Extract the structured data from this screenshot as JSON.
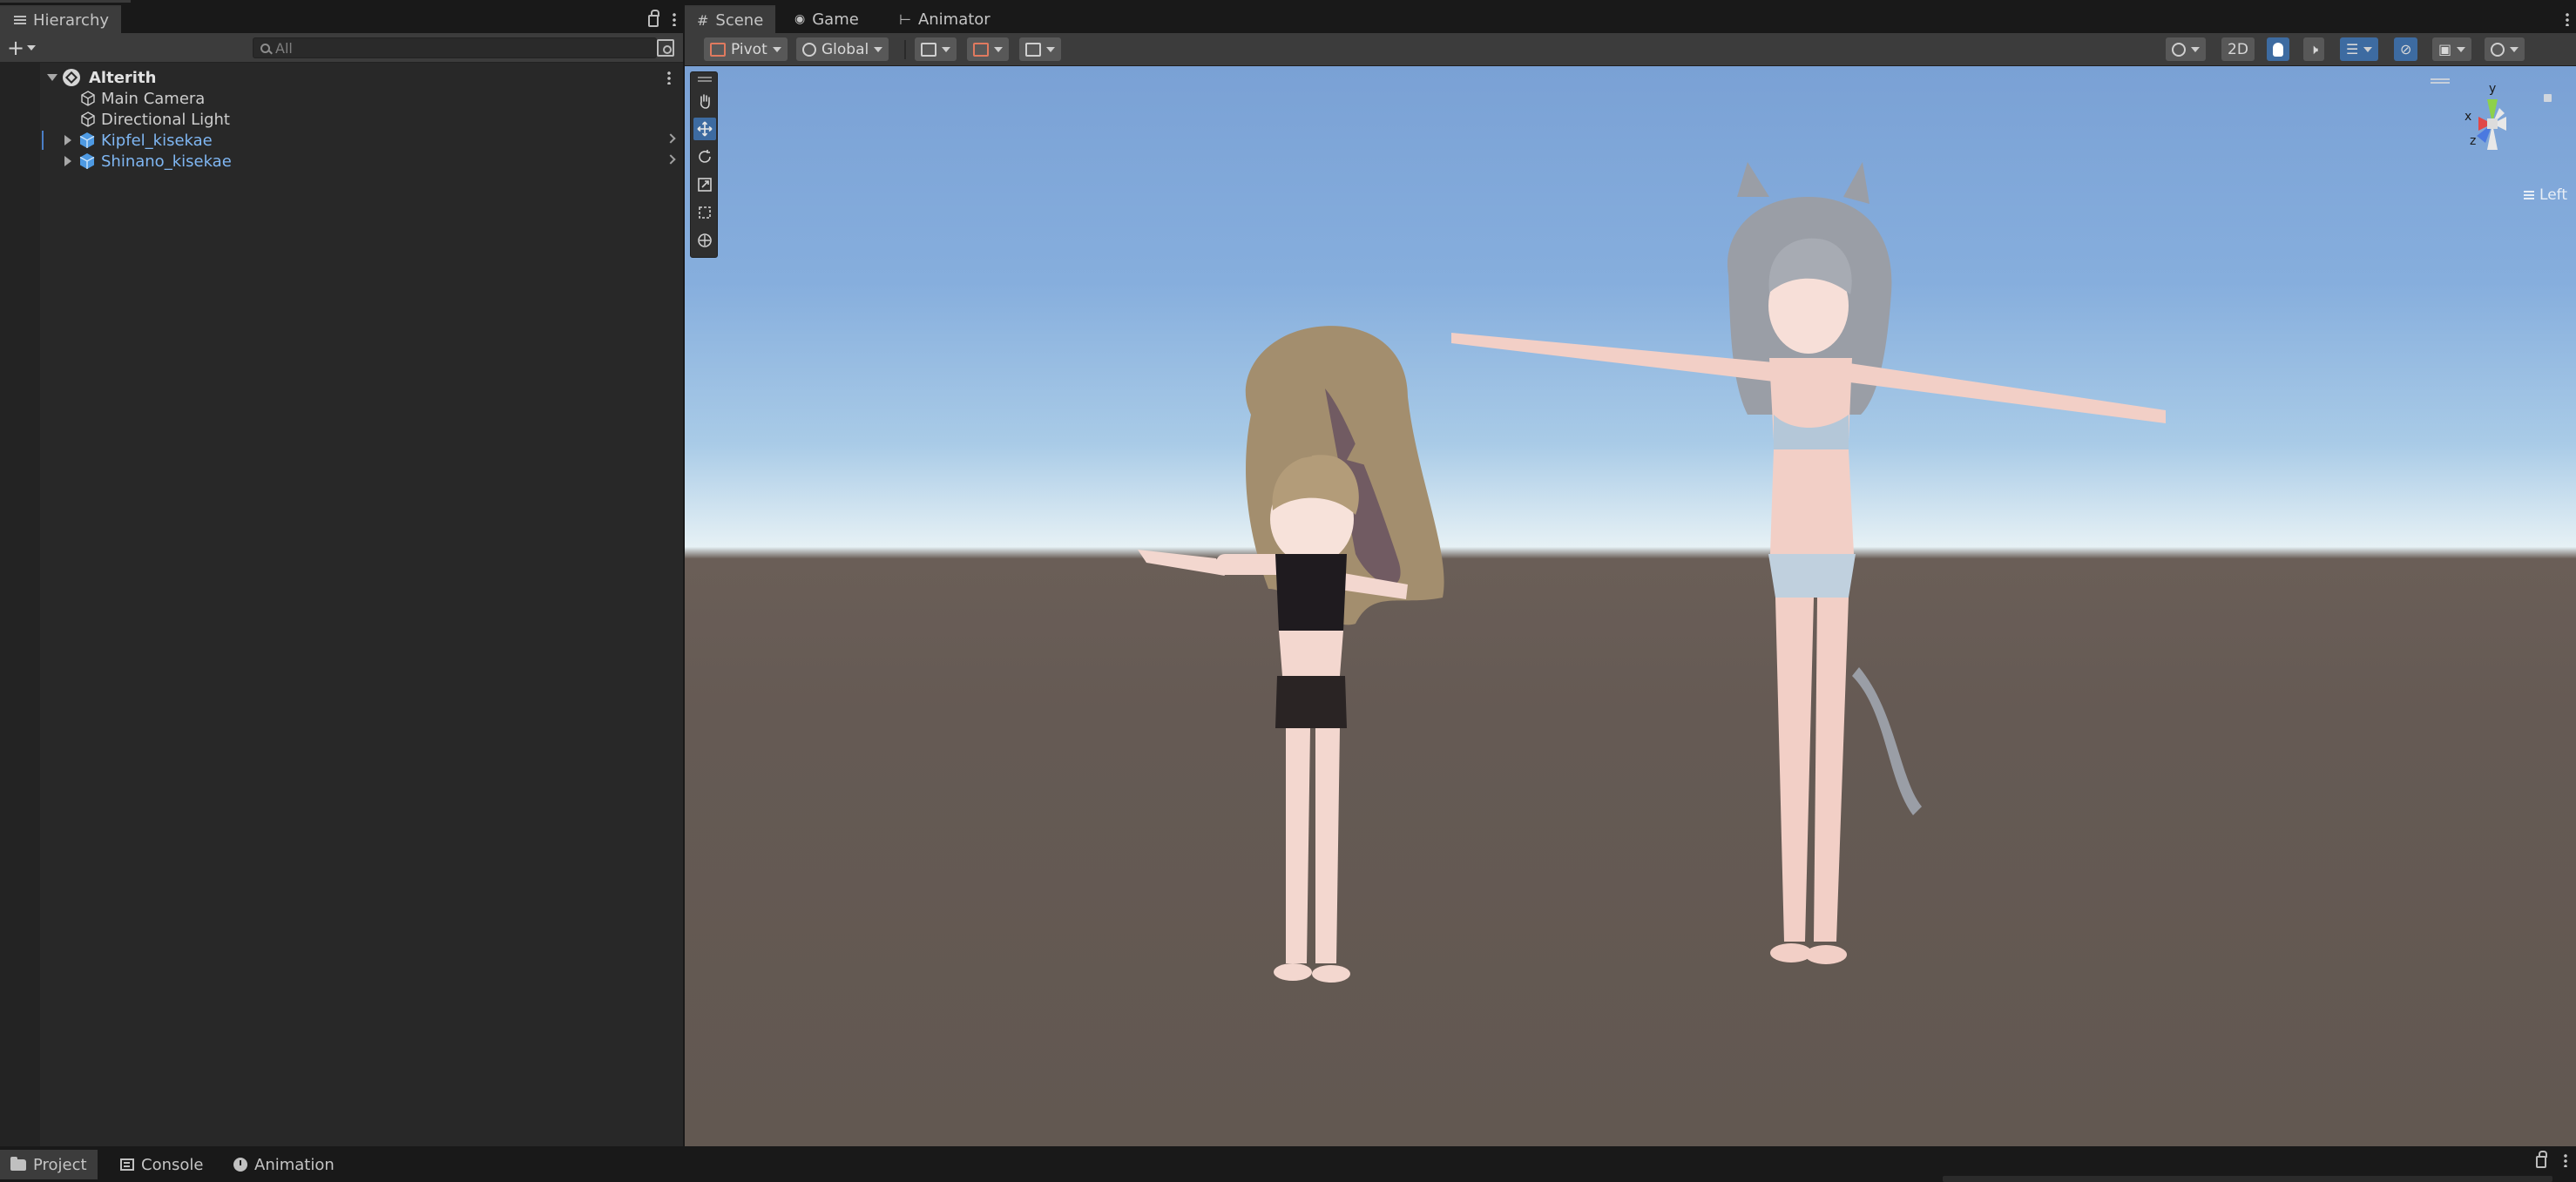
{
  "hierarchy": {
    "tab_label": "Hierarchy",
    "add_symbol": "+",
    "search_placeholder": "All",
    "scene_root": "Alterith",
    "items": [
      {
        "label": "Main Camera",
        "type": "gameobject"
      },
      {
        "label": "Directional Light",
        "type": "gameobject"
      },
      {
        "label": "Kipfel_kisekae",
        "type": "prefab"
      },
      {
        "label": "Shinano_kisekae",
        "type": "prefab"
      }
    ]
  },
  "scene": {
    "tabs": [
      {
        "label": "Scene",
        "icon": "grid-icon",
        "active": true
      },
      {
        "label": "Game",
        "icon": "gamepad-icon",
        "active": false
      },
      {
        "label": "Animator",
        "icon": "animator-icon",
        "active": false
      }
    ],
    "toolbar": {
      "pivot_label": "Pivot",
      "global_label": "Global",
      "mode_2d_label": "2D"
    },
    "tools": [
      "hand-tool",
      "move-tool",
      "rotate-tool",
      "scale-tool",
      "rect-tool",
      "transform-tool"
    ],
    "active_tool": "move-tool",
    "gizmo": {
      "axis_x": "x",
      "axis_y": "y",
      "axis_z": "z",
      "view_label": "Left"
    }
  },
  "bottom": {
    "tabs": [
      {
        "label": "Project",
        "icon": "folder-icon",
        "active": true
      },
      {
        "label": "Console",
        "icon": "console-icon",
        "active": false
      },
      {
        "label": "Animation",
        "icon": "clock-icon",
        "active": false
      }
    ]
  },
  "colors": {
    "accent": "#3d6ba1",
    "prefab_text": "#7fb6f2",
    "panel_bg": "#282828",
    "toolbar_bg": "#3c3c3c"
  }
}
